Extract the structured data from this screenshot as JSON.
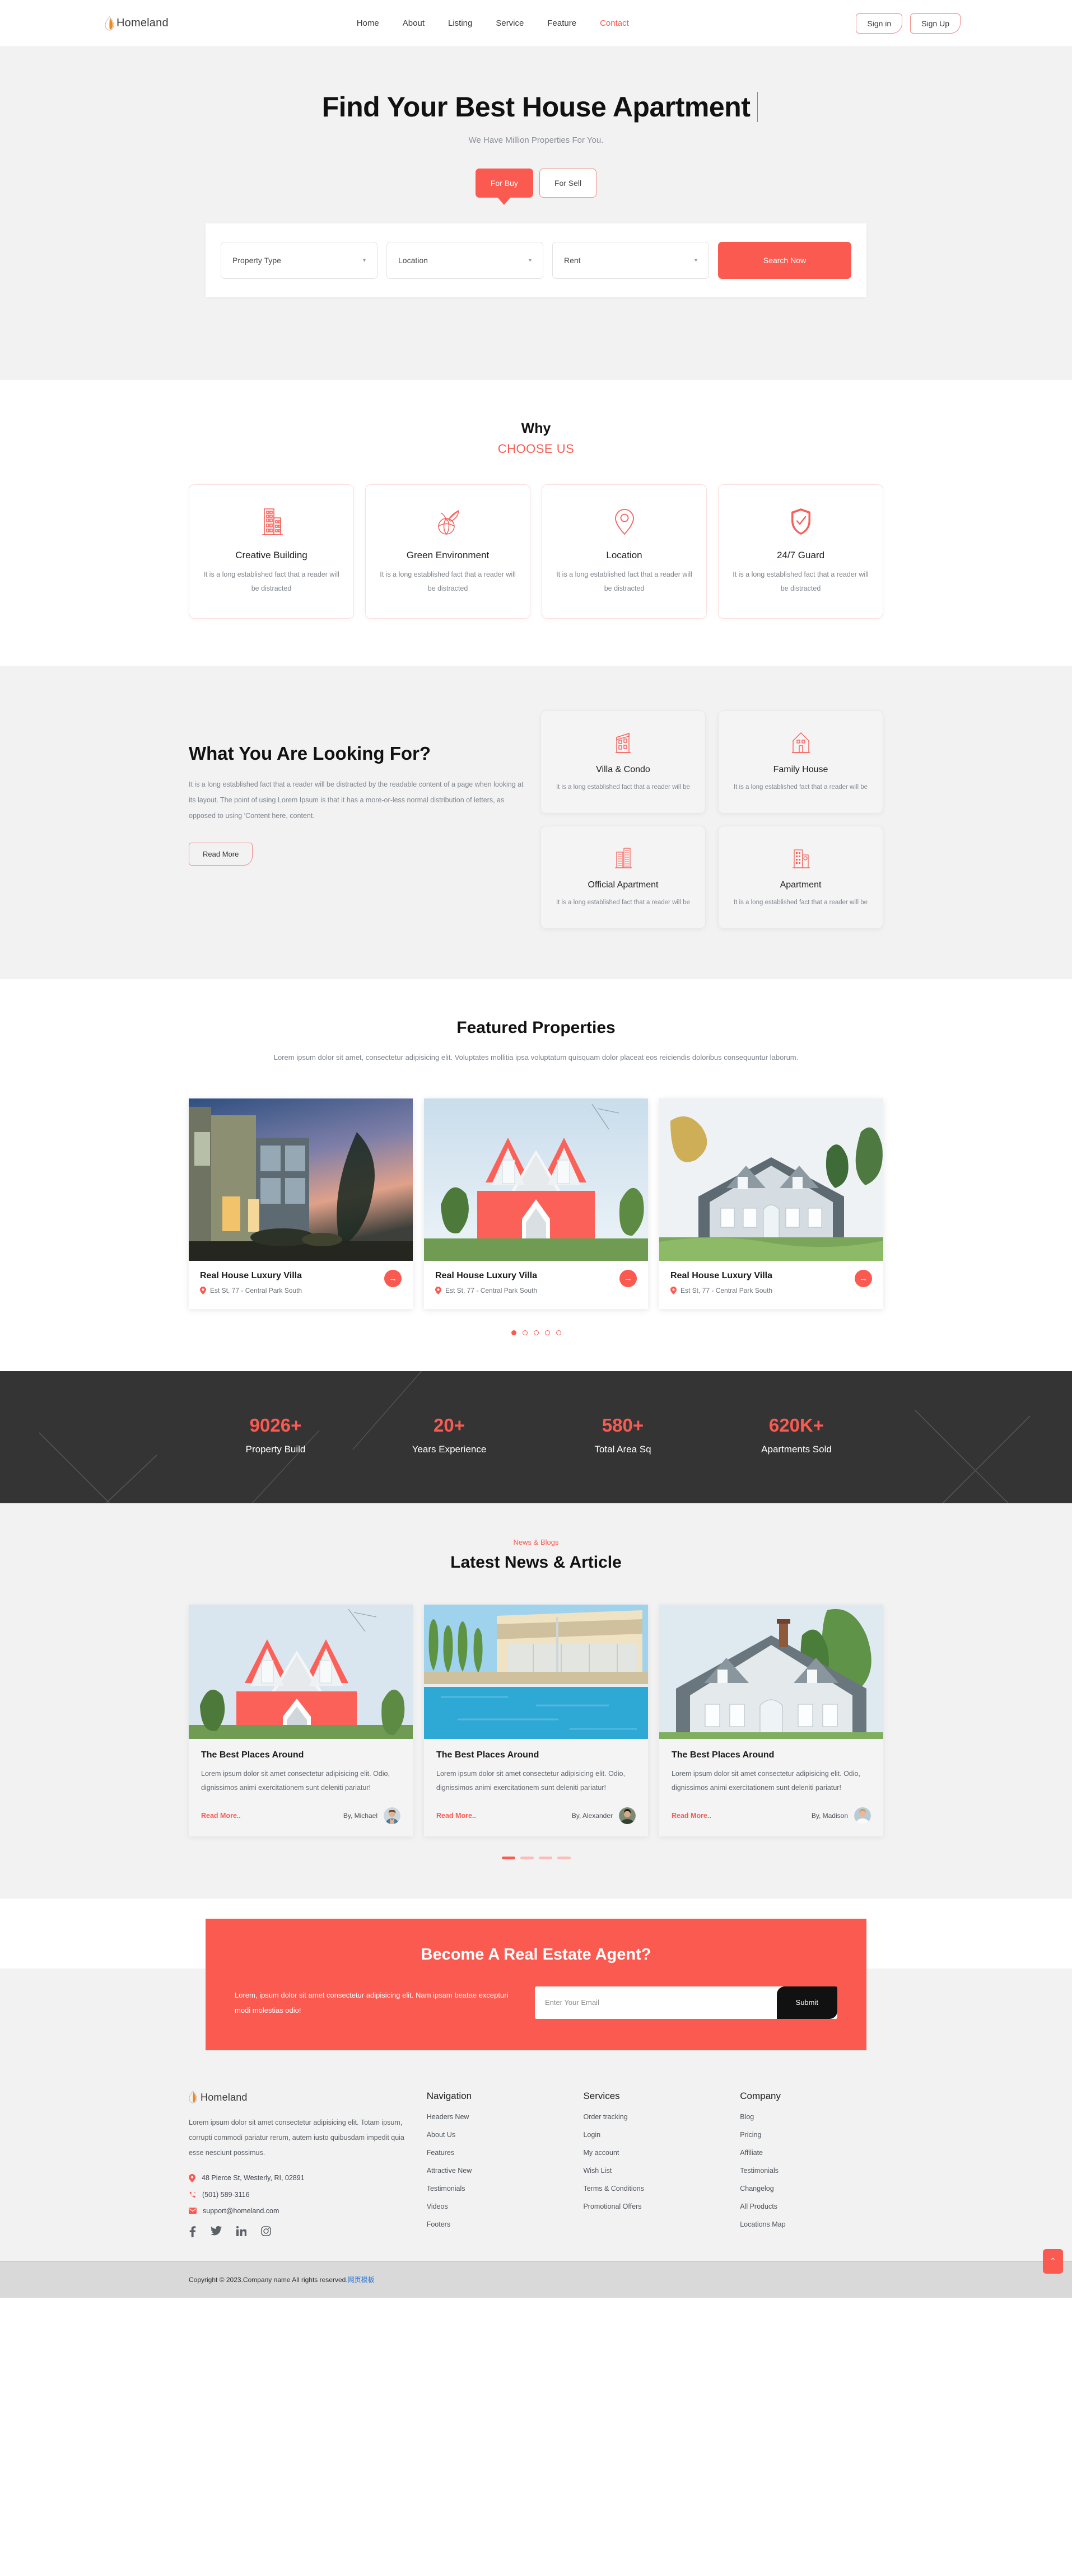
{
  "header": {
    "brand": "Homeland",
    "nav": [
      {
        "label": "Home",
        "active": false
      },
      {
        "label": "About",
        "active": false
      },
      {
        "label": "Listing",
        "active": false
      },
      {
        "label": "Service",
        "active": false
      },
      {
        "label": "Feature",
        "active": false
      },
      {
        "label": "Contact",
        "active": true
      }
    ],
    "sign_in": "Sign in",
    "sign_up": "Sign Up"
  },
  "hero": {
    "title": "Find Your Best House Apartment",
    "subtitle": "We Have Million Properties For You.",
    "toggle_buy": "For Buy",
    "toggle_sell": "For Sell",
    "select_property_type": "Property Type",
    "select_location": "Location",
    "select_rent": "Rent",
    "search_button": "Search Now"
  },
  "why": {
    "title_line1": "Why",
    "title_line2": "CHOOSE US",
    "cards": [
      {
        "icon": "building-icon",
        "title": "Creative Building",
        "text": "It is a long established fact that a reader will be distracted"
      },
      {
        "icon": "eco-globe-icon",
        "title": "Green Environment",
        "text": "It is a long established fact that a reader will be distracted"
      },
      {
        "icon": "map-pin-icon",
        "title": "Location",
        "text": "It is a long established fact that a reader will be distracted"
      },
      {
        "icon": "shield-check-icon",
        "title": "24/7 Guard",
        "text": "It is a long established fact that a reader will be distracted"
      }
    ]
  },
  "looking": {
    "heading": "What You Are Looking For?",
    "body": "It is a long established fact that a reader will be distracted by the readable content of a page when looking at its layout. The point of using Lorem Ipsum is that it has a more-or-less normal distribution of letters, as opposed to using 'Content here, content.",
    "read_more": "Read More",
    "cards": [
      {
        "icon": "villa-icon",
        "title": "Villa & Condo",
        "text": "It is a long established fact that a reader will be"
      },
      {
        "icon": "family-house-icon",
        "title": "Family House",
        "text": "It is a long established fact that a reader will be"
      },
      {
        "icon": "office-tower-icon",
        "title": "Official Apartment",
        "text": "It is a long established fact that a reader will be"
      },
      {
        "icon": "apartment-icon",
        "title": "Apartment",
        "text": "It is a long established fact that a reader will be"
      }
    ]
  },
  "featured": {
    "heading": "Featured Properties",
    "lead": "Lorem ipsum dolor sit amet, consectetur adipisicing elit. Voluptates mollitia ipsa voluptatum quisquam dolor placeat eos reiciendis doloribus consequuntur laborum.",
    "cards": [
      {
        "title": "Real House Luxury Villa",
        "location": "Est St, 77 - Central Park South",
        "arrow": "→"
      },
      {
        "title": "Real House Luxury Villa",
        "location": "Est St, 77 - Central Park South",
        "arrow": "→"
      },
      {
        "title": "Real House Luxury Villa",
        "location": "Est St, 77 - Central Park South",
        "arrow": "→"
      }
    ],
    "dots": 5,
    "active_dot": 0
  },
  "stats": [
    {
      "number": "9026+",
      "label": "Property Build"
    },
    {
      "number": "20+",
      "label": "Years Experience"
    },
    {
      "number": "580+",
      "label": "Total Area Sq"
    },
    {
      "number": "620K+",
      "label": "Apartments Sold"
    }
  ],
  "blog": {
    "kicker": "News & Blogs",
    "heading": "Latest News & Article",
    "cards": [
      {
        "title": "The Best Places Around",
        "text": "Lorem ipsum dolor sit amet consectetur adipisicing elit. Odio, dignissimos animi exercitationem sunt deleniti pariatur!",
        "read_more": "Read More..",
        "author": "By, Michael"
      },
      {
        "title": "The Best Places Around",
        "text": "Lorem ipsum dolor sit amet consectetur adipisicing elit. Odio, dignissimos animi exercitationem sunt deleniti pariatur!",
        "read_more": "Read More..",
        "author": "By, Alexander"
      },
      {
        "title": "The Best Places Around",
        "text": "Lorem ipsum dolor sit amet consectetur adipisicing elit. Odio, dignissimos animi exercitationem sunt deleniti pariatur!",
        "read_more": "Read More..",
        "author": "By, Madison"
      }
    ],
    "dashes": 4,
    "active_dash": 0
  },
  "cta": {
    "heading": "Become A Real Estate Agent?",
    "text": "Lorem, ipsum dolor sit amet consectetur adipisicing elit. Nam ipsam beatae excepturi modi molestias odio!",
    "email_placeholder": "Enter Your Email",
    "email_value": "",
    "submit": "Submit"
  },
  "footer": {
    "brand": "Homeland",
    "about": "Lorem ipsum dolor sit amet consectetur adipisicing elit. Totam ipsum, corrupti commodi pariatur rerum, autem iusto quibusdam impedit quia esse nesciunt possimus.",
    "address": "48 Pierce St, Westerly, RI, 02891",
    "phone": "(501) 589-3116",
    "email": "support@homeland.com",
    "socials": [
      "facebook-icon",
      "twitter-icon",
      "linkedin-icon",
      "instagram-icon"
    ],
    "columns": [
      {
        "title": "Navigation",
        "links": [
          "Headers New",
          "About Us",
          "Features",
          "Attractive New",
          "Testimonials",
          "Videos",
          "Footers"
        ]
      },
      {
        "title": "Services",
        "links": [
          "Order tracking",
          "Login",
          "My account",
          "Wish List",
          "Terms & Conditions",
          "Promotional Offers"
        ]
      },
      {
        "title": "Company",
        "links": [
          "Blog",
          "Pricing",
          "Affiliate",
          "Testimonials",
          "Changelog",
          "All Products",
          "Locations Map"
        ]
      }
    ],
    "copyright": "Copyright © 2023.Company name All rights reserved.",
    "copyright_link": "网页模板",
    "to_top": "⌃"
  },
  "colors": {
    "accent": "#fb5a51",
    "dark": "#343434",
    "page_gray": "#f2f2f2"
  }
}
